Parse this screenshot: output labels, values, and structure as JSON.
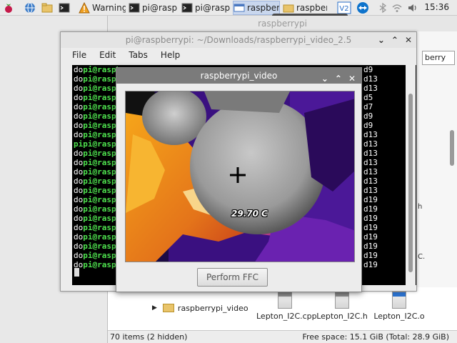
{
  "taskbar": {
    "warning_label": "Warning",
    "tasks": [
      "pi@rasp",
      "pi@rasp",
      "raspberr",
      "raspberr"
    ],
    "clock": "15:36",
    "tooltip": "raspberrypi_video"
  },
  "file_manager": {
    "title": "raspberrypi",
    "search_value": "berry",
    "tree_item": "raspberrypi_video",
    "files": [
      {
        "name": "Lepton_I2C.cpp"
      },
      {
        "name": "Lepton_I2C.h"
      },
      {
        "name": "Lepton_I2C.o"
      }
    ],
    "side_labels": [
      "h",
      "C."
    ],
    "status_left": "70 items (2 hidden)",
    "status_right": "Free space: 15.1 GiB (Total: 28.9 GiB)"
  },
  "terminal": {
    "title": "pi@raspberrypi: ~/Downloads/raspberrypi_video_2.5",
    "menu": [
      "File",
      "Edit",
      "Tabs",
      "Help"
    ],
    "prefixes": [
      "do",
      "do",
      "do",
      "do",
      "do",
      "do",
      "do",
      "do",
      "pi",
      "do",
      "do",
      "do",
      "do",
      "do",
      "do",
      "do",
      "do",
      "do",
      "do",
      "do",
      "do",
      "do"
    ],
    "right_col": [
      "d9",
      "d13",
      "d13",
      "d5",
      "d7",
      "d9",
      "d9",
      "d13",
      "d13",
      "d13",
      "d13",
      "d13",
      "d13",
      "d13",
      "d19",
      "d19",
      "d19",
      "d19",
      "d19",
      "d19",
      "d19",
      "d19"
    ],
    "prompt_text": "pi@raspbe"
  },
  "video_window": {
    "title": "raspberrypi_video",
    "temperature": "29.70 C",
    "ffc_button": "Perform FFC"
  },
  "colors": {
    "prompt_green": "#4fe34f",
    "thermal_orange": "#f08a10",
    "thermal_purple": "#5b1aa0",
    "thermal_black": "#0e0620"
  }
}
